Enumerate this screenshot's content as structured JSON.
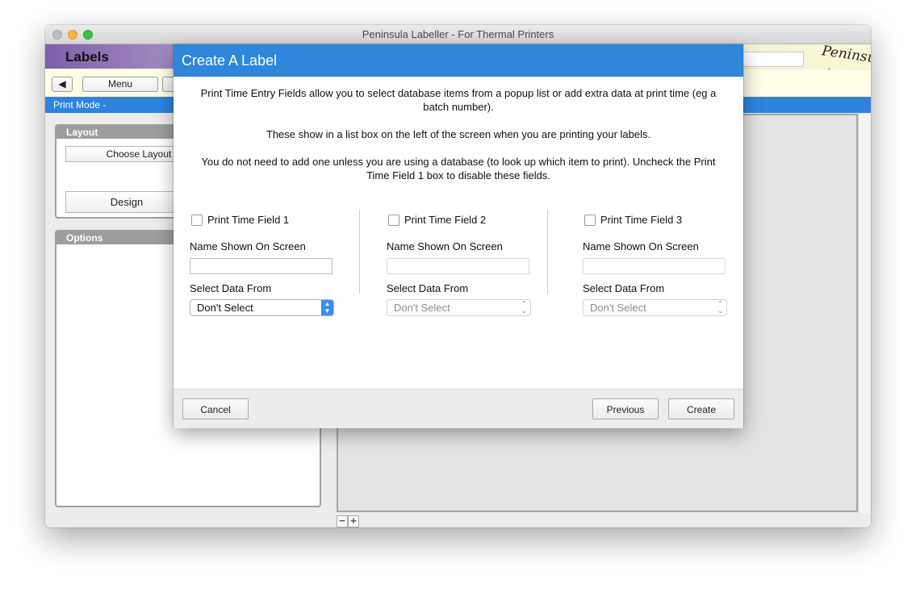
{
  "window": {
    "title": "Peninsula Labeller - For Thermal Printers"
  },
  "header": {
    "title": "Labels",
    "logo": "Peninsula"
  },
  "toolbar": {
    "back_icon": "triangle-left-icon",
    "menu_label": "Menu"
  },
  "mode_bar": {
    "text": "Print Mode -"
  },
  "layout_panel": {
    "title": "Layout",
    "choose_label": "Choose Layout",
    "design_label": "Design"
  },
  "options_panel": {
    "title": "Options"
  },
  "dialog": {
    "title": "Create A Label",
    "paragraph1": "Print Time Entry Fields allow you to select database items from a popup list or add extra data at print time (eg a batch number).",
    "paragraph2": "These show in a list box on the left of the screen when you are printing your labels.",
    "paragraph3": "You do not need to add one unless you are using a database (to look up which item to print). Uncheck the Print Time Field 1 box to disable these fields.",
    "fields": [
      {
        "checkbox_label": "Print Time Field 1",
        "name_label": "Name Shown On Screen",
        "name_value": "",
        "select_label": "Select Data From",
        "select_value": "Don't Select"
      },
      {
        "checkbox_label": "Print Time Field 2",
        "name_label": "Name Shown On Screen",
        "name_value": "",
        "select_label": "Select Data From",
        "select_value": "Don't Select"
      },
      {
        "checkbox_label": "Print Time Field 3",
        "name_label": "Name Shown On Screen",
        "name_value": "",
        "select_label": "Select Data From",
        "select_value": "Don't Select"
      }
    ],
    "buttons": {
      "cancel": "Cancel",
      "previous": "Previous",
      "create": "Create"
    }
  },
  "zoom": {
    "minus": "−",
    "plus": "+"
  }
}
